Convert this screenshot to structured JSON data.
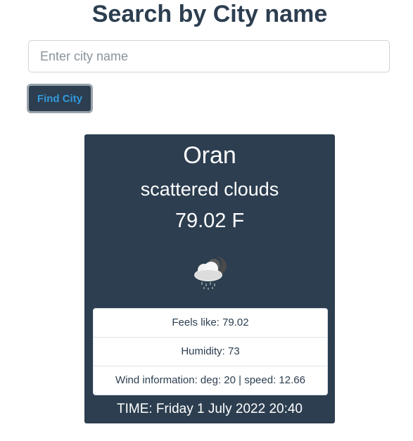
{
  "header": {
    "title": "Search by City name"
  },
  "search": {
    "placeholder": "Enter city name",
    "value": "",
    "button_label": "Find City"
  },
  "weather": {
    "city": "Oran",
    "description": "scattered clouds",
    "temperature": "79.02 F",
    "icon": "cloud-rain-night-icon",
    "details": [
      {
        "text": "Feels like: 79.02"
      },
      {
        "text": "Humidity: 73"
      },
      {
        "text": "Wind information: deg: 20 | speed: 12.66"
      }
    ],
    "time": "TIME: Friday 1 July 2022 20:40"
  },
  "colors": {
    "primary": "#2c3e50",
    "button_text": "#3498db",
    "card_text": "#ffffff"
  }
}
